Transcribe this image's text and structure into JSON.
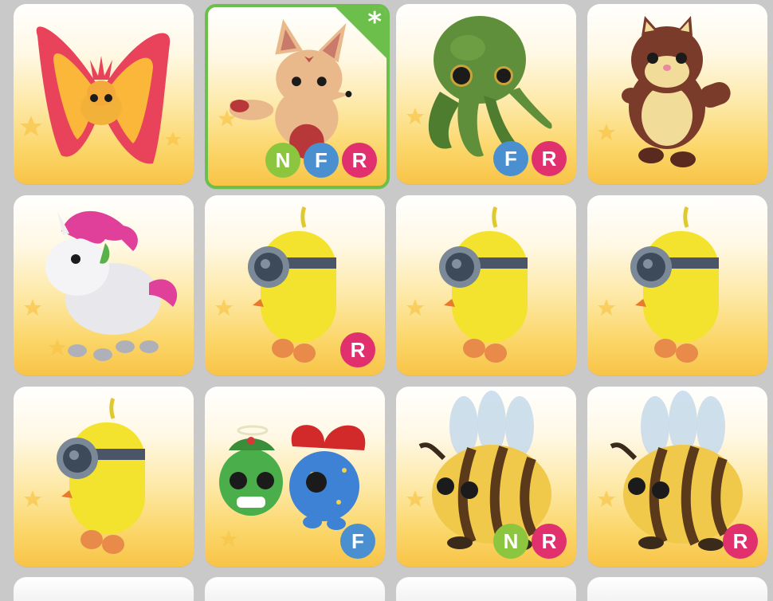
{
  "inventory": {
    "slots": [
      {
        "pet": "butterfly-pet-icon",
        "badges": [],
        "selected": false
      },
      {
        "pet": "fox-pet-icon",
        "badges": [
          "N",
          "F",
          "R"
        ],
        "selected": true
      },
      {
        "pet": "octopus-pet-icon",
        "badges": [
          "F",
          "R"
        ],
        "selected": false
      },
      {
        "pet": "squirrel-pet-icon",
        "badges": [],
        "selected": false
      },
      {
        "pet": "unicorn-pet-icon",
        "badges": [],
        "selected": false
      },
      {
        "pet": "minion-pet-icon",
        "badges": [
          "R"
        ],
        "selected": false
      },
      {
        "pet": "minion-pet-icon",
        "badges": [],
        "selected": false
      },
      {
        "pet": "minion-pet-icon",
        "badges": [],
        "selected": false
      },
      {
        "pet": "minion-pet-icon",
        "badges": [],
        "selected": false
      },
      {
        "pet": "holiday-duo-pet-icon",
        "badges": [
          "F"
        ],
        "selected": false
      },
      {
        "pet": "bee-pet-icon",
        "badges": [
          "N",
          "R"
        ],
        "selected": false
      },
      {
        "pet": "bee-pet-icon",
        "badges": [
          "R"
        ],
        "selected": false
      }
    ],
    "selected_marker": "*"
  },
  "colors": {
    "neon": "#8cc63f",
    "fly": "#4a8fd0",
    "ride": "#e0306e",
    "selected_border": "#6cbf4a",
    "background": "#c9c9c9"
  }
}
